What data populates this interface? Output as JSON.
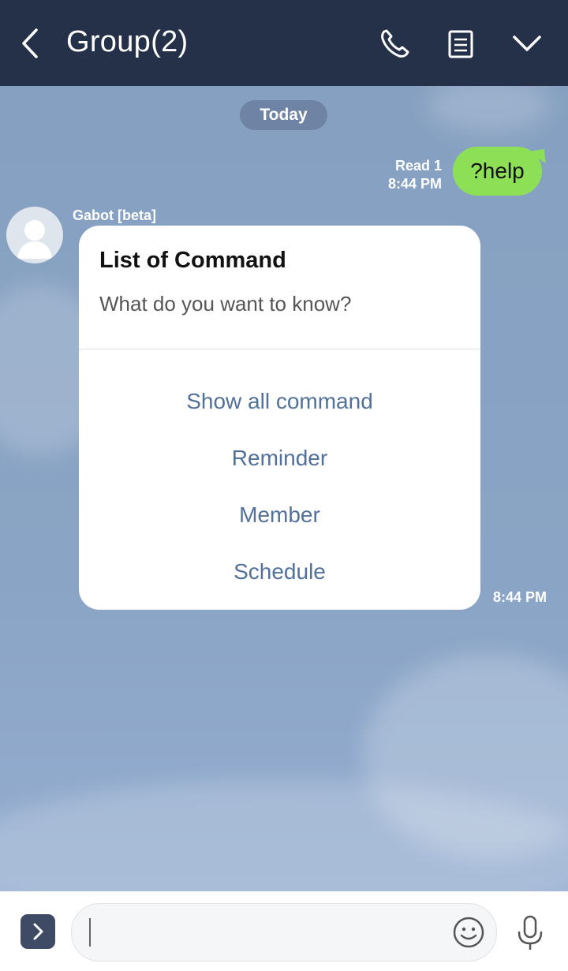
{
  "header": {
    "title": "Group(2)",
    "icons": [
      "back-icon",
      "call-icon",
      "notes-icon",
      "chevron-down-icon"
    ]
  },
  "chat": {
    "date_divider": "Today",
    "my_message": {
      "text": "?help",
      "read_status": "Read 1",
      "time": "8:44 PM",
      "bubble_color": "#8de055"
    },
    "bot_message": {
      "sender": "Gabot [beta]",
      "card_title": "List of Command",
      "card_subtitle": "What do you want to know?",
      "actions": [
        "Show all command",
        "Reminder",
        "Member",
        "Schedule"
      ],
      "time": "8:44 PM"
    }
  },
  "composer": {
    "input_value": "",
    "icons": [
      "expand-icon",
      "emoji-icon",
      "mic-icon"
    ]
  },
  "colors": {
    "header_bg": "#253149",
    "chat_bg": "#86a0c1",
    "action_text": "#51709a"
  }
}
